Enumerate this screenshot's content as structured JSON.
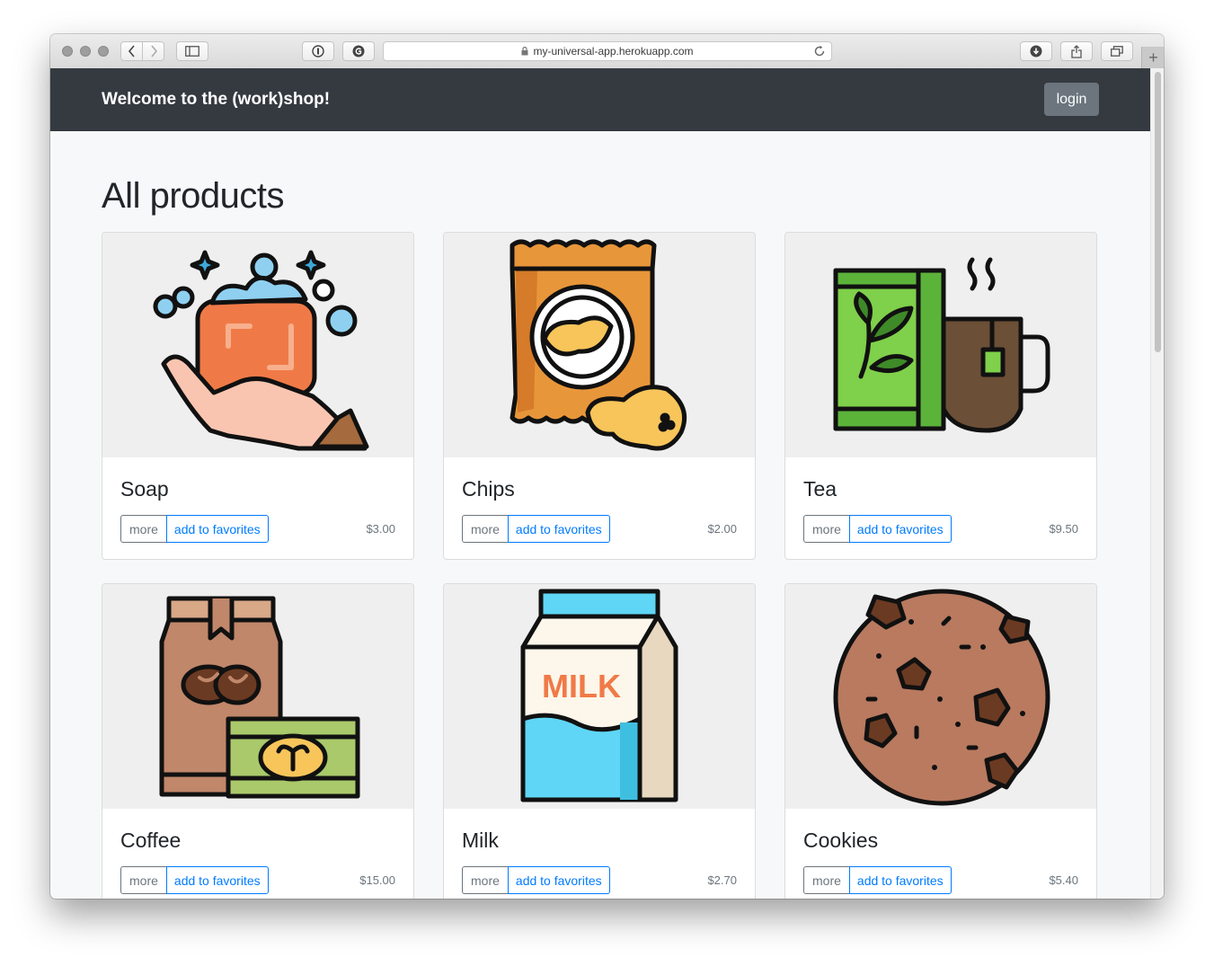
{
  "browser": {
    "url": "my-universal-app.herokuapp.com",
    "icons": {
      "back": "chevron-left-icon",
      "forward": "chevron-right-icon",
      "sidebar": "sidebar-icon",
      "password": "password-icon",
      "extension": "extension-icon",
      "lock": "lock-icon",
      "reload": "reload-icon",
      "downloads": "download-icon",
      "share": "share-icon",
      "tabs": "tabs-icon",
      "new_tab": "plus-icon"
    }
  },
  "navbar": {
    "brand": "Welcome to the (work)shop!",
    "login_label": "login"
  },
  "main": {
    "title": "All products",
    "more_label": "more",
    "favorites_label": "add to favorites",
    "products": [
      {
        "name": "Soap",
        "price": "$3.00",
        "icon": "soap-icon"
      },
      {
        "name": "Chips",
        "price": "$2.00",
        "icon": "chips-icon"
      },
      {
        "name": "Tea",
        "price": "$9.50",
        "icon": "tea-icon"
      },
      {
        "name": "Coffee",
        "price": "$15.00",
        "icon": "coffee-icon"
      },
      {
        "name": "Milk",
        "price": "$2.70",
        "icon": "milk-icon"
      },
      {
        "name": "Cookies",
        "price": "$5.40",
        "icon": "cookie-icon"
      }
    ]
  },
  "colors": {
    "navbar": "#343a40",
    "primary": "#007bff",
    "secondary": "#6c757d"
  }
}
